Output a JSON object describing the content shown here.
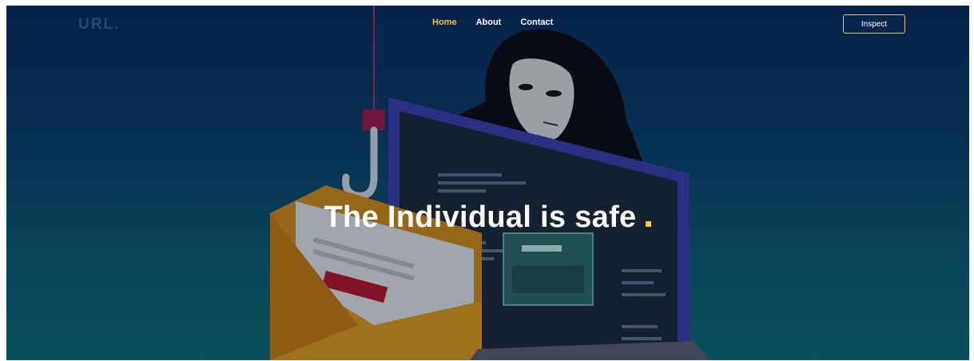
{
  "nav": {
    "logo": "URL.",
    "links": [
      {
        "label": "Home",
        "active": true
      },
      {
        "label": "About",
        "active": false
      },
      {
        "label": "Contact",
        "active": false
      }
    ],
    "cta_label": "Inspect"
  },
  "hero": {
    "headline": "The Individual is safe",
    "dot_symbol": "."
  },
  "colors": {
    "accent": "#f2c14e",
    "background_top": "#0a2c5c",
    "background_bottom": "#0d6b74"
  }
}
